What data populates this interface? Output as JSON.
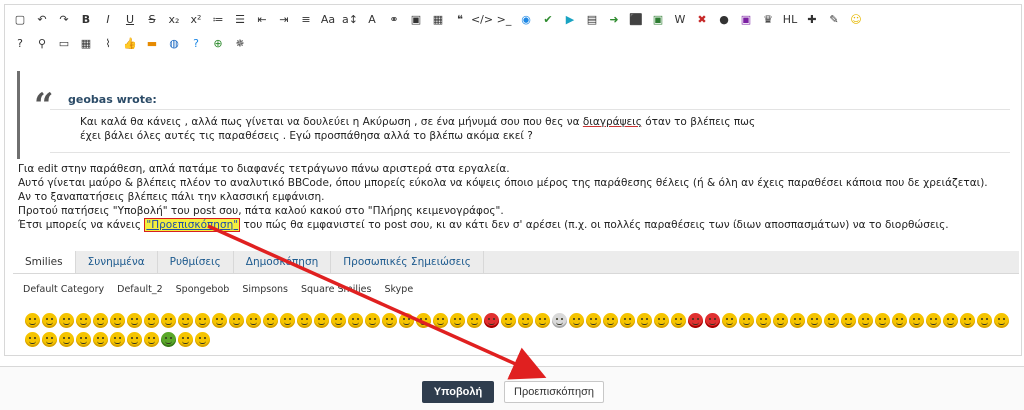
{
  "toolbar": {
    "row1": [
      "square-icon",
      "undo-icon",
      "redo-icon",
      "bold-icon",
      "italic-icon",
      "underline-icon",
      "strikethrough-icon",
      "subscript-icon",
      "superscript-icon",
      "ordered-list-icon",
      "unordered-list-icon",
      "outdent-icon",
      "indent-icon",
      "align-icon",
      "font-size-icon",
      "font-size-adjust-icon",
      "font-color-icon",
      "link-icon",
      "image-icon",
      "table-icon",
      "quote-icon",
      "code-icon",
      "terminal-icon",
      "media-icon",
      "check-icon",
      "play-icon",
      "archive-icon",
      "share-icon",
      "pdf-icon",
      "excel-icon",
      "wiki-icon",
      "close-app-icon",
      "bomb-icon",
      "theme-icon",
      "trophy-icon",
      "hl-icon",
      "puzzle-icon",
      "tool-icon",
      "smiley-icon"
    ],
    "labels": {
      "bold": "B",
      "italic": "I",
      "underline": "U",
      "strike": "S",
      "sub": "x₂",
      "sup": "x²",
      "fontsize": "Aa",
      "fontsize2": "a↕",
      "color": "A",
      "hl": "HL",
      "wiki": "W"
    },
    "row2": [
      "help-icon",
      "pin-icon",
      "box-icon",
      "grid-icon",
      "attach-icon",
      "like-icon",
      "film-icon",
      "globe-icon",
      "question-icon",
      "add-icon",
      "rebel-icon"
    ]
  },
  "quote": {
    "author": "geobas wrote:",
    "line1_a": "Και καλά θα κάνεις , αλλά πως γίνεται να δουλεύει η Ακύρωση , σε ένα μήνυμά σου που θες να ",
    "line1_link": "διαγράψεις",
    "line1_b": " όταν το βλέπεις πως",
    "line2": "έχει βάλει όλες αυτές τις παραθέσεις . Εγώ προσπάθησα αλλά το βλέπω ακόμα εκεί ?"
  },
  "body": {
    "line1": "Για edit στην παράθεση, απλά πατάμε το διαφανές τετράγωνο πάνω αριστερά στα εργαλεία.",
    "line2": "Αυτό γίνεται μαύρο & βλέπεις πλέον το αναλυτικό BBCode, όπου μπορείς εύκολα να κόψεις όποιο μέρος της παράθεσης θέλεις (ή & όλη αν έχεις παραθέσει κάποια που δε χρειάζεται).",
    "line3": "Αν το ξαναπατήσεις βλέπεις πάλι την κλασσική εμφάνιση.",
    "line4": "Προτού πατήσεις \"Υποβολή\" του post σου, πάτα καλού κακού στο \"Πλήρης κειμενογράφος\".",
    "line5_a": "Έτσι μπορείς να κάνεις ",
    "line5_hl": "\"Προεπισκόπηση\"",
    "line5_b": " του πώς θα εμφανιστεί το post σου, κι αν κάτι δεν σ' αρέσει (π.χ. οι πολλές παραθέσεις των ίδιων αποσπασμάτων) να το διορθώσεις."
  },
  "tabs": [
    "Smilies",
    "Συνημμένα",
    "Ρυθμίσεις",
    "Δημοσκόπηση",
    "Προσωπικές Σημειώσεις"
  ],
  "categories": [
    "Default Category",
    "Default_2",
    "Spongebob",
    "Simpsons",
    "Square Smilies",
    "Skype"
  ],
  "buttons": {
    "submit": "Υποβολή",
    "preview": "Προεπισκόπηση"
  },
  "colors": {
    "arrow": "#e02020",
    "submit_bg": "#2f3d4e",
    "highlight": "#f4ef3e"
  }
}
